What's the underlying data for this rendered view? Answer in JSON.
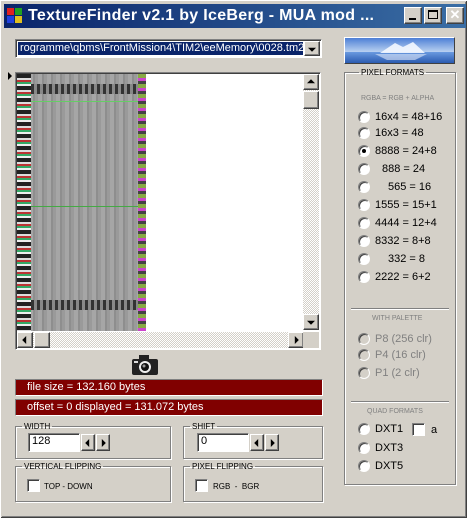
{
  "window": {
    "title": "TextureFinder v2.1 by IceBerg - MUA mod ..."
  },
  "file": {
    "path": "rogramme\\qbms\\FrontMission4\\TIM2\\eeMemory\\0028.tm2"
  },
  "info": {
    "file_size": "file size = 132.160 bytes",
    "offset": "offset = 0   displayed = 131.072 bytes"
  },
  "width": {
    "legend": "WIDTH",
    "value": "128"
  },
  "shift": {
    "legend": "SHIFT",
    "value": "0"
  },
  "vertical_flipping": {
    "legend": "VERTICAL FLIPPING",
    "label": "TOP - DOWN"
  },
  "pixel_flipping": {
    "legend": "PIXEL FLIPPING",
    "label": "RGB  -  BGR"
  },
  "pixel_formats": {
    "legend": "PIXEL FORMATS",
    "subheading": "RGBA = RGB + ALPHA",
    "options": [
      "16x4 = 48+16",
      "16x3 = 48",
      "8888 = 24+8",
      "888 = 24",
      "565 = 16",
      "1555 = 15+1",
      "4444 = 12+4",
      "8332 = 8+8",
      "332 = 8",
      "2222 = 6+2"
    ],
    "selected": "8888 = 24+8"
  },
  "palette": {
    "subheading": "WITH PALETTE",
    "options": [
      "P8  (256 clr)",
      "P4  (16 clr)",
      "P1  (2 clr)"
    ]
  },
  "quad_formats": {
    "subheading": "QUAD FORMATS",
    "options": [
      "DXT1",
      "DXT3",
      "DXT5"
    ],
    "dxt1_checkbox_label": "a"
  },
  "icons": [
    "app-icon",
    "minimize-icon",
    "maximize-icon",
    "close-icon",
    "dropdown-arrow-icon",
    "camera-icon",
    "iceberg-logo"
  ],
  "colors": {
    "titlebar_start": "#0a246a",
    "titlebar_end": "#3a6ea5",
    "info_bar": "#800000",
    "face": "#d4d0c8"
  }
}
